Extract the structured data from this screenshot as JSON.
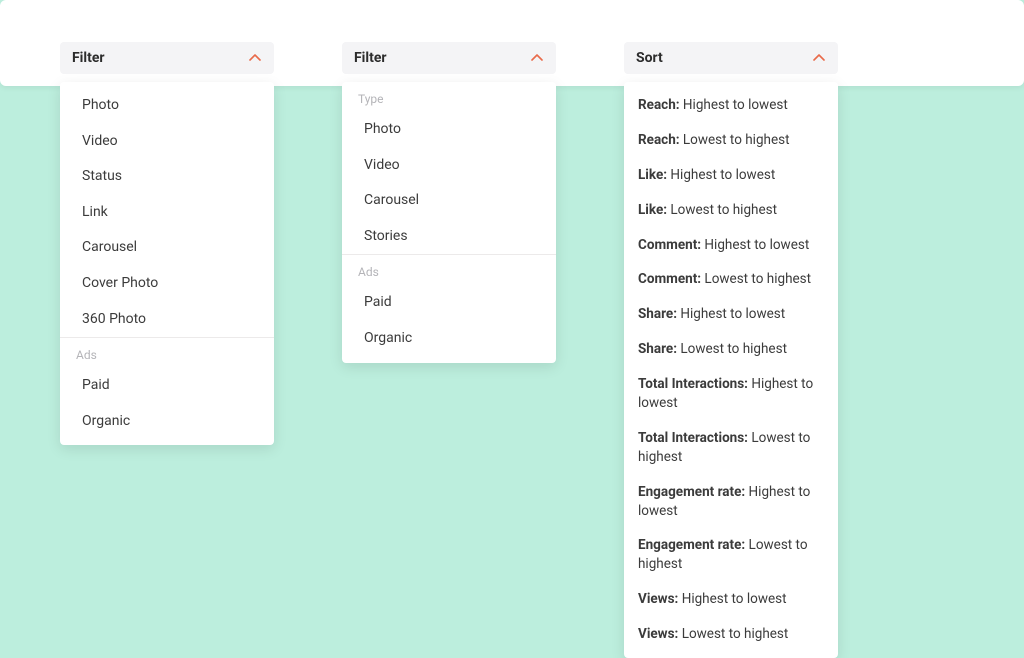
{
  "colors": {
    "accent": "#e96a4a",
    "bg": "#bceedd",
    "header_bg": "#f4f4f6"
  },
  "columns": [
    {
      "header": "Filter",
      "sections": [
        {
          "label": null,
          "items": [
            "Photo",
            "Video",
            "Status",
            "Link",
            "Carousel",
            "Cover Photo",
            "360 Photo"
          ]
        },
        {
          "label": "Ads",
          "items": [
            "Paid",
            "Organic"
          ]
        }
      ]
    },
    {
      "header": "Filter",
      "sections": [
        {
          "label": "Type",
          "items": [
            "Photo",
            "Video",
            "Carousel",
            "Stories"
          ]
        },
        {
          "label": "Ads",
          "items": [
            "Paid",
            "Organic"
          ]
        }
      ]
    },
    {
      "header": "Sort",
      "sort_items": [
        {
          "metric": "Reach",
          "direction": "Highest to lowest"
        },
        {
          "metric": "Reach",
          "direction": "Lowest to highest"
        },
        {
          "metric": "Like",
          "direction": "Highest to lowest"
        },
        {
          "metric": "Like",
          "direction": "Lowest to highest"
        },
        {
          "metric": "Comment",
          "direction": "Highest to lowest"
        },
        {
          "metric": "Comment",
          "direction": "Lowest to highest"
        },
        {
          "metric": "Share",
          "direction": "Highest to lowest"
        },
        {
          "metric": "Share",
          "direction": "Lowest to highest"
        },
        {
          "metric": "Total Interactions",
          "direction": "Highest to lowest"
        },
        {
          "metric": "Total Interactions",
          "direction": "Lowest to highest"
        },
        {
          "metric": "Engagement rate",
          "direction": "Highest to lowest"
        },
        {
          "metric": "Engagement rate",
          "direction": "Lowest to highest"
        },
        {
          "metric": "Views",
          "direction": "Highest to lowest"
        },
        {
          "metric": "Views",
          "direction": "Lowest to highest"
        }
      ]
    }
  ]
}
